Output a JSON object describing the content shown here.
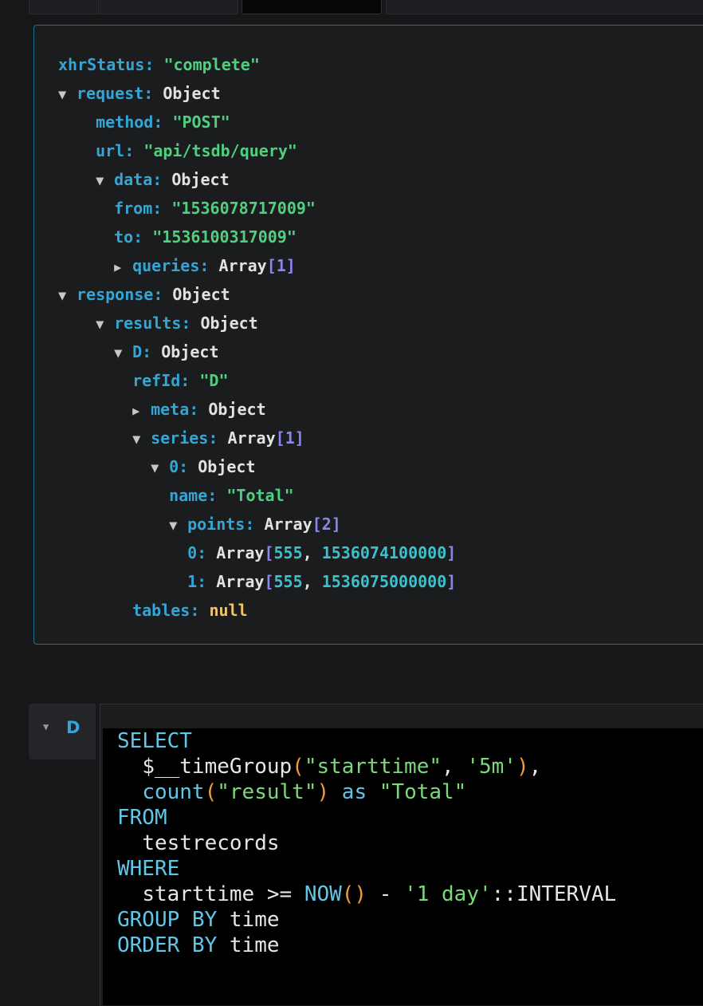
{
  "inspector": {
    "xhrStatus_key": "xhrStatus:",
    "xhrStatus_value": "\"complete\"",
    "request_key": "request:",
    "request_type": "Object",
    "method_key": "method:",
    "method_value": "\"POST\"",
    "url_key": "url:",
    "url_value": "\"api/tsdb/query\"",
    "data_key": "data:",
    "data_type": "Object",
    "from_key": "from:",
    "from_value": "\"1536078717009\"",
    "to_key": "to:",
    "to_value": "\"1536100317009\"",
    "queries_key": "queries:",
    "queries_type": "Array",
    "queries_count": "1",
    "response_key": "response:",
    "response_type": "Object",
    "results_key": "results:",
    "results_type": "Object",
    "d_key": "D:",
    "d_type": "Object",
    "refid_key": "refId:",
    "refid_value": "\"D\"",
    "meta_key": "meta:",
    "meta_type": "Object",
    "series_key": "series:",
    "series_type": "Array",
    "series_count": "1",
    "s0_key": "0:",
    "s0_type": "Object",
    "name_key": "name:",
    "name_value": "\"Total\"",
    "points_key": "points:",
    "points_type": "Array",
    "points_count": "2",
    "p0_key": "0:",
    "p0_type": "Array",
    "p0_v1": "555",
    "p0_v2": "1536074100000",
    "p1_key": "1:",
    "p1_type": "Array",
    "p1_v1": "555",
    "p1_v2": "1536075000000",
    "tables_key": "tables:",
    "tables_value": "null"
  },
  "query": {
    "letter": "D",
    "collapse_icon": "caret-down-icon",
    "sql": {
      "select": "SELECT",
      "timegroup_fn": "$__timeGroup",
      "timegroup_arg1": "\"starttime\"",
      "timegroup_sep": ", ",
      "timegroup_arg2": "'5m'",
      "count_fn": "count",
      "count_arg": "\"result\"",
      "as_kw": "as",
      "alias": "\"Total\"",
      "from_kw": "FROM",
      "table": "testrecords",
      "where_kw": "WHERE",
      "where_col": "starttime >=",
      "now_fn": "NOW",
      "minus": "-",
      "interval_str": "'1 day'",
      "interval_cast": "::INTERVAL",
      "group_kw": "GROUP BY",
      "group_col": "time",
      "order_kw": "ORDER BY",
      "order_col": "time"
    }
  },
  "colors": {
    "key": "#33a6d6",
    "string": "#4fd07f",
    "bracket": "#8c84f0",
    "number": "#3cc0cc",
    "null": "#f0c46a",
    "border_accent": "#21718b",
    "sql_keyword": "#5fc8e8",
    "sql_paren": "#f39c3b"
  }
}
